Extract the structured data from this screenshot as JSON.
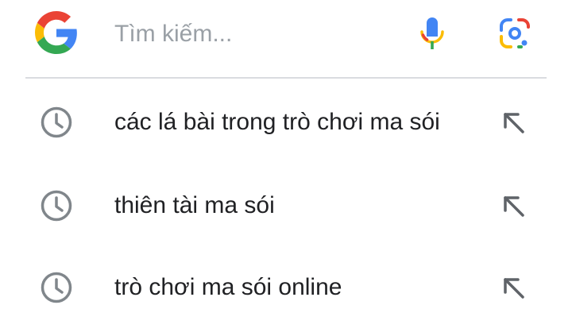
{
  "search": {
    "placeholder": "Tìm kiếm...",
    "logo_icon": "google-g-icon",
    "voice_icon": "mic-icon",
    "lens_icon": "camera-lens-icon"
  },
  "suggestions": [
    {
      "text": "các lá bài trong trò chơi ma sói",
      "icon": "history-icon",
      "action_icon": "fill-query-arrow-icon"
    },
    {
      "text": "thiên tài ma sói",
      "icon": "history-icon",
      "action_icon": "fill-query-arrow-icon"
    },
    {
      "text": "trò chơi ma sói online",
      "icon": "history-icon",
      "action_icon": "fill-query-arrow-icon"
    }
  ],
  "colors": {
    "google_blue": "#4285F4",
    "google_red": "#EA4335",
    "google_yellow": "#FBBC05",
    "google_green": "#34A853",
    "icon_gray": "#80868b",
    "text": "#202124",
    "placeholder": "#9aa0a6",
    "divider": "#dadce0"
  }
}
